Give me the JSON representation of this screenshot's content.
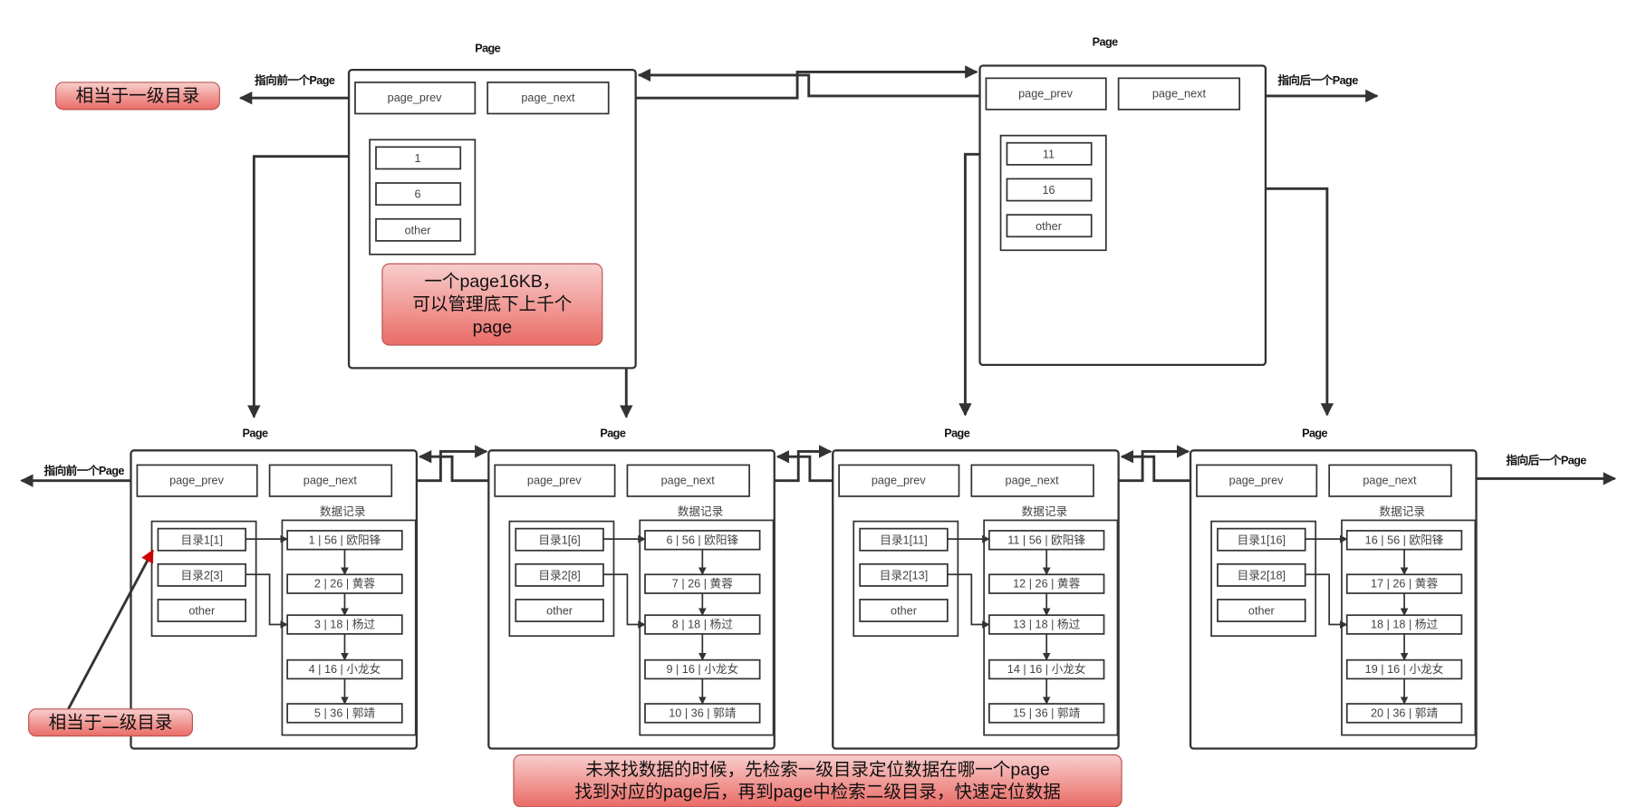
{
  "colors": {
    "note_top": "#f8cecc",
    "note_bottom": "#ea6b66",
    "note_border": "#b85450",
    "red_arrow": "#cc0000",
    "line": "#333333"
  },
  "labels": {
    "page_title": "Page",
    "prev_page": "指向前一个Page",
    "next_page": "指向后一个Page",
    "records_title": "数据记录",
    "page_prev": "page_prev",
    "page_next": "page_next"
  },
  "notes": {
    "level1": "相当于一级目录",
    "level2": "相当于二级目录",
    "page_size": [
      "一个page16KB，",
      "可以管理底下上千个",
      "page"
    ],
    "search": [
      "未来找数据的时候，先检索一级目录定位数据在哪一个page",
      "找到对应的page后，再到page中检索二级目录，快速定位数据"
    ]
  },
  "top_pages": [
    {
      "index": [
        "1",
        "6",
        "other"
      ]
    },
    {
      "index": [
        "11",
        "16",
        "other"
      ]
    }
  ],
  "leaf_pages": [
    {
      "directory": [
        "目录1[1]",
        "目录2[3]",
        "other"
      ],
      "records": [
        "1 | 56 | 欧阳锋",
        "2 | 26 | 黄蓉",
        "3 | 18 | 杨过",
        "4 | 16 | 小龙女",
        "5 | 36 | 郭靖"
      ]
    },
    {
      "directory": [
        "目录1[6]",
        "目录2[8]",
        "other"
      ],
      "records": [
        "6 |  56 | 欧阳锋",
        "7 |  26 | 黄蓉",
        "8 |  18 | 杨过",
        "9 |  16 | 小龙女",
        "10 |  36 | 郭靖"
      ]
    },
    {
      "directory": [
        "目录1[11]",
        "目录2[13]",
        "other"
      ],
      "records": [
        "11 |  56 | 欧阳锋",
        "12 |  26 | 黄蓉",
        "13 |  18 | 杨过",
        "14 |  16 | 小龙女",
        "15 |  36 | 郭靖"
      ]
    },
    {
      "directory": [
        "目录1[16]",
        "目录2[18]",
        "other"
      ],
      "records": [
        "16 |  56 | 欧阳锋",
        "17 |  26 | 黄蓉",
        "18 |  18 | 杨过",
        "19 |  16 | 小龙女",
        "20 |  36 | 郭靖"
      ]
    }
  ]
}
